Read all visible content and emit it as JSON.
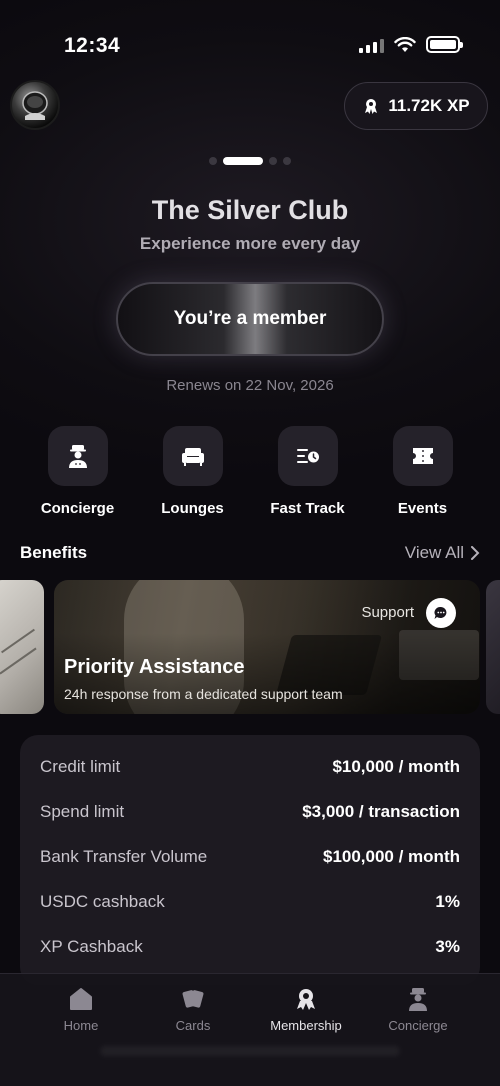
{
  "status_bar": {
    "time": "12:34",
    "battery_level": 1.0
  },
  "header": {
    "xp_label": "11.72K XP"
  },
  "pager": {
    "count": 4,
    "active_index": 1
  },
  "club": {
    "title": "The Silver Club",
    "subtitle": "Experience more every day",
    "member_button": "You’re a member",
    "renews": "Renews on 22 Nov, 2026"
  },
  "actions": [
    {
      "label": "Concierge",
      "icon": "concierge-icon"
    },
    {
      "label": "Lounges",
      "icon": "sofa-icon"
    },
    {
      "label": "Fast Track",
      "icon": "fast-track-icon"
    },
    {
      "label": "Events",
      "icon": "ticket-icon"
    }
  ],
  "benefits": {
    "title": "Benefits",
    "view_all": "View All",
    "card": {
      "tag": "Support",
      "title": "Priority Assistance",
      "subtitle": "24h response from a dedicated support team"
    }
  },
  "limits": [
    {
      "label": "Credit limit",
      "value": "$10,000 / month"
    },
    {
      "label": "Spend limit",
      "value": "$3,000 / transaction"
    },
    {
      "label": "Bank Transfer Volume",
      "value": "$100,000 / month"
    },
    {
      "label": "USDC cashback",
      "value": "1%"
    },
    {
      "label": "XP Cashback",
      "value": "3%"
    }
  ],
  "tabs": [
    {
      "label": "Home",
      "icon": "home-icon",
      "active": false
    },
    {
      "label": "Cards",
      "icon": "cards-icon",
      "active": false
    },
    {
      "label": "Membership",
      "icon": "membership-icon",
      "active": true
    },
    {
      "label": "Concierge",
      "icon": "concierge-icon",
      "active": false
    }
  ],
  "colors": {
    "background": "#0d0b10",
    "panel": "#1d1a21",
    "tile": "#25222a",
    "muted_text": "#8a8690"
  }
}
